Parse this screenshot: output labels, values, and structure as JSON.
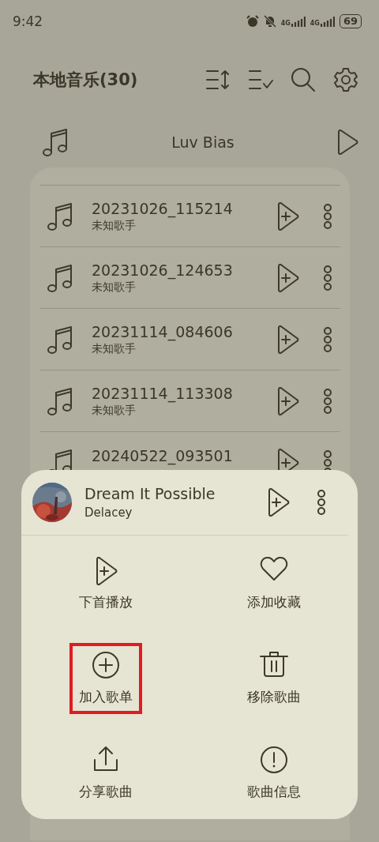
{
  "status_bar": {
    "time": "9:42",
    "networks": [
      "4G",
      "4G"
    ],
    "battery": "69"
  },
  "header": {
    "title": "本地音乐(30)"
  },
  "now_playing": {
    "title": "Luv Bias"
  },
  "songs": [
    {
      "title": "20231026_115214",
      "artist": "未知歌手"
    },
    {
      "title": "20231026_124653",
      "artist": "未知歌手"
    },
    {
      "title": "20231114_084606",
      "artist": "未知歌手"
    },
    {
      "title": "20231114_113308",
      "artist": "未知歌手"
    },
    {
      "title": "20240522_093501"
    }
  ],
  "sheet": {
    "title": "Dream It Possible",
    "artist": "Delacey",
    "actions": [
      {
        "kind": "play-next",
        "label": "下首播放",
        "highlighted": false
      },
      {
        "kind": "favorite",
        "label": "添加收藏",
        "highlighted": false
      },
      {
        "kind": "add-playlist",
        "label": "加入歌单",
        "highlighted": true
      },
      {
        "kind": "remove",
        "label": "移除歌曲",
        "highlighted": false
      },
      {
        "kind": "share",
        "label": "分享歌曲",
        "highlighted": false
      },
      {
        "kind": "info",
        "label": "歌曲信息",
        "highlighted": false
      }
    ]
  }
}
